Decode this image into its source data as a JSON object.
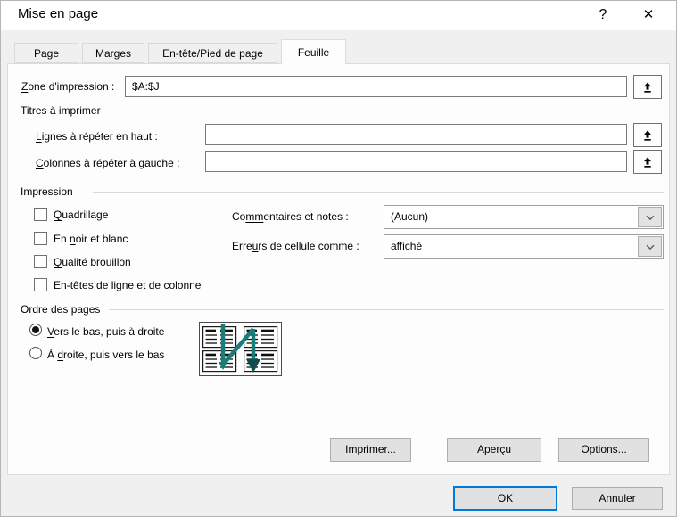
{
  "titlebar": {
    "title": "Mise en page",
    "help_glyph": "?",
    "close_glyph": "✕"
  },
  "tabs": {
    "page": "Page",
    "margins": "Marges",
    "header_footer": "En-tête/Pied de page",
    "sheet": "Feuille",
    "active_tab": "Feuille"
  },
  "fields": {
    "print_area": {
      "label_pre": "",
      "label_key": "Z",
      "label_post": "one d'impression :",
      "value": "$A:$J"
    },
    "repeat_rows": {
      "label_pre": "",
      "label_key": "L",
      "label_post": "ignes à répéter en haut :",
      "value": ""
    },
    "repeat_cols": {
      "label_pre": "",
      "label_key": "C",
      "label_post": "olonnes à répéter à gauche :",
      "value": ""
    }
  },
  "groups": {
    "print_titles": "Titres à imprimer",
    "print": "Impression",
    "page_order": "Ordre des pages"
  },
  "checkboxes": {
    "gridlines": {
      "pre": "",
      "key": "Q",
      "post": "uadrillage",
      "checked": false
    },
    "black_white": {
      "pre": "En ",
      "key": "n",
      "post": "oir et blanc",
      "checked": false
    },
    "draft": {
      "pre": "",
      "key": "Q",
      "post": "ualité brouillon",
      "checked": false
    },
    "headings": {
      "pre": "En-",
      "key": "t",
      "post": "êtes de ligne et de colonne",
      "checked": false
    }
  },
  "dropdowns": {
    "comments": {
      "label_pre": "Co",
      "label_key": "mm",
      "label_post": "entaires et notes :",
      "value": "(Aucun)"
    },
    "cell_errors": {
      "label_pre": "Erre",
      "label_key": "u",
      "label_post": "rs de cellule comme :",
      "value": "affiché"
    }
  },
  "radios": {
    "down_then_over": {
      "pre": "",
      "key": "V",
      "post": "ers le bas, puis à droite",
      "selected": true
    },
    "over_then_down": {
      "pre": "À ",
      "key": "d",
      "post": "roite, puis vers le bas",
      "selected": false
    }
  },
  "buttons": {
    "print": {
      "pre": "",
      "key": "I",
      "post": "mprimer..."
    },
    "preview": {
      "pre": "Ape",
      "key": "r",
      "post": "çu"
    },
    "options": {
      "pre": "",
      "key": "O",
      "post": "ptions..."
    },
    "ok": "OK",
    "cancel": "Annuler"
  },
  "icons": {
    "help": "question-mark",
    "close": "close-x",
    "collapse_dialog": "up-arrow-with-bar",
    "dropdown": "chevron-down",
    "page_order_preview": "four-pages-with-teal-n-arrow"
  },
  "colors": {
    "accent": "#0078d7",
    "arrow": "#1b7d7a",
    "arrow_head": "#0e4f4d",
    "titlebar_bg": "#ffffff",
    "dialog_bg": "#f0f0f0"
  }
}
